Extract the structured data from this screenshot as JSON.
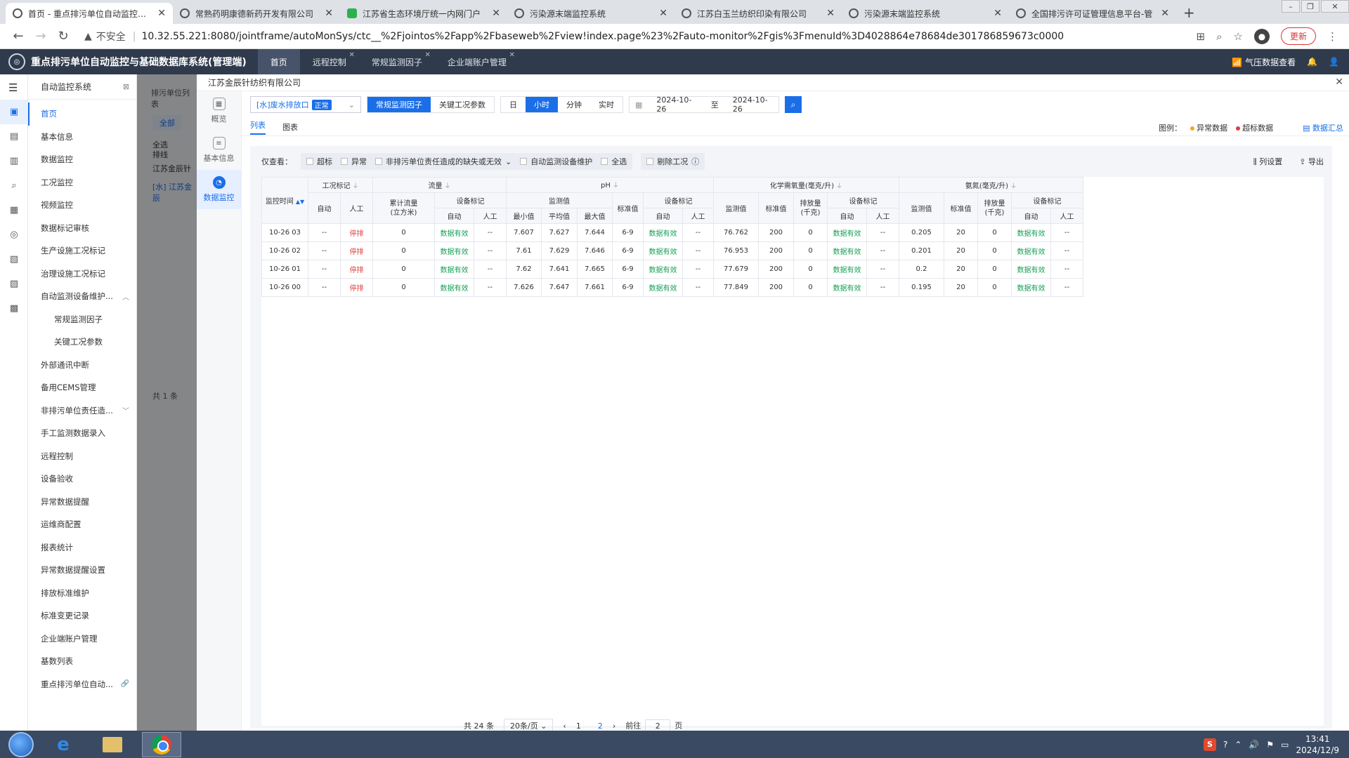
{
  "browser": {
    "tabs": [
      {
        "label": "首页 - 重点排污单位自动监控与基",
        "active": true,
        "green": false
      },
      {
        "label": "常熟药明康德新药开发有限公司",
        "active": false,
        "green": false
      },
      {
        "label": "江苏省生态环境厅统一内网门户",
        "active": false,
        "green": true
      },
      {
        "label": "污染源末端监控系统",
        "active": false,
        "green": false
      },
      {
        "label": "江苏白玉兰纺织印染有限公司",
        "active": false,
        "green": false
      },
      {
        "label": "污染源末端监控系统",
        "active": false,
        "green": false
      },
      {
        "label": "全国排污许可证管理信息平台-管",
        "active": false,
        "green": false
      }
    ],
    "insecure_label": "不安全",
    "url": "10.32.55.221:8080/jointframe/autoMonSys/ctc__%2Fjointos%2Fapp%2Fbaseweb%2Fview!index.page%23%2Fauto-monitor%2Fgis%3FmenuId%3D4028864e78684de301786859673c0000",
    "update_label": "更新"
  },
  "app": {
    "title": "重点排污单位自动监控与基础数据库系统(管理端)",
    "tabs": [
      "首页",
      "远程控制",
      "常规监测因子",
      "企业端账户管理"
    ],
    "right_link": "气压数据查看"
  },
  "sidebar": {
    "title": "自动监控系统",
    "items": [
      {
        "label": "首页",
        "active": true,
        "sub": false,
        "chev": ""
      },
      {
        "label": "基本信息",
        "active": false,
        "sub": false,
        "chev": ""
      },
      {
        "label": "数据监控",
        "active": false,
        "sub": false,
        "chev": ""
      },
      {
        "label": "工况监控",
        "active": false,
        "sub": false,
        "chev": ""
      },
      {
        "label": "视频监控",
        "active": false,
        "sub": false,
        "chev": ""
      },
      {
        "label": "数据标记审核",
        "active": false,
        "sub": false,
        "chev": ""
      },
      {
        "label": "生产设施工况标记",
        "active": false,
        "sub": false,
        "chev": ""
      },
      {
        "label": "治理设施工况标记",
        "active": false,
        "sub": false,
        "chev": ""
      },
      {
        "label": "自动监测设备维护...",
        "active": false,
        "sub": false,
        "chev": "︿"
      },
      {
        "label": "常规监测因子",
        "active": false,
        "sub": true,
        "chev": ""
      },
      {
        "label": "关键工况参数",
        "active": false,
        "sub": true,
        "chev": ""
      },
      {
        "label": "外部通讯中断",
        "active": false,
        "sub": false,
        "chev": ""
      },
      {
        "label": "备用CEMS管理",
        "active": false,
        "sub": false,
        "chev": ""
      },
      {
        "label": "非排污单位责任造...",
        "active": false,
        "sub": false,
        "chev": "﹀"
      },
      {
        "label": "手工监测数据录入",
        "active": false,
        "sub": false,
        "chev": ""
      },
      {
        "label": "远程控制",
        "active": false,
        "sub": false,
        "chev": ""
      },
      {
        "label": "设备验收",
        "active": false,
        "sub": false,
        "chev": ""
      },
      {
        "label": "异常数据提醒",
        "active": false,
        "sub": false,
        "chev": ""
      },
      {
        "label": "运维商配置",
        "active": false,
        "sub": false,
        "chev": ""
      },
      {
        "label": "报表统计",
        "active": false,
        "sub": false,
        "chev": ""
      },
      {
        "label": "异常数据提醒设置",
        "active": false,
        "sub": false,
        "chev": ""
      },
      {
        "label": "排放标准维护",
        "active": false,
        "sub": false,
        "chev": ""
      },
      {
        "label": "标准变更记录",
        "active": false,
        "sub": false,
        "chev": ""
      },
      {
        "label": "企业端账户管理",
        "active": false,
        "sub": false,
        "chev": ""
      },
      {
        "label": "基数列表",
        "active": false,
        "sub": false,
        "chev": ""
      },
      {
        "label": "重点排污单位自动...",
        "active": false,
        "sub": false,
        "chev": "🔗"
      }
    ]
  },
  "background_page": {
    "title": "排污单位列表",
    "all_button": "全部",
    "check_all": "全选",
    "check_waste": "排线",
    "company": "江苏金辰针",
    "item": "[水] 江苏金辰",
    "total": "共 1 条"
  },
  "modal": {
    "title": "江苏金辰针纺织有限公司",
    "rail": [
      {
        "label": "概览",
        "icon": "▦",
        "active": false
      },
      {
        "label": "基本信息",
        "icon": "≡",
        "active": false
      },
      {
        "label": "数据监控",
        "icon": "◔",
        "active": true
      }
    ],
    "outlet_prefix": "[水]",
    "outlet_name": "废水排放口",
    "outlet_status": "正常",
    "factor_tabs": [
      {
        "label": "常规监测因子",
        "on": true
      },
      {
        "label": "关键工况参数",
        "on": false
      }
    ],
    "time_tabs": [
      {
        "label": "日",
        "on": false
      },
      {
        "label": "小时",
        "on": true
      },
      {
        "label": "分钟",
        "on": false
      },
      {
        "label": "实时",
        "on": false
      }
    ],
    "date_from": "2024-10-26",
    "date_to_sep": "至",
    "date_to": "2024-10-26",
    "view_tabs": [
      {
        "label": "列表",
        "on": true
      },
      {
        "label": "图表",
        "on": false
      }
    ],
    "legend_label": "图例：",
    "legend_abnormal": "异常数据",
    "legend_over": "超标数据",
    "legend_abnormal_color": "#f5a623",
    "legend_over_color": "#e03c3c",
    "summary": "数据汇总",
    "filter_label": "仅查看：",
    "filters": [
      "超标",
      "异常",
      "非排污单位责任造成的缺失或无效",
      "自动监测设备维护",
      "全选"
    ],
    "delete_cond": "剔除工况",
    "col_setting": "列设置",
    "export": "导出"
  },
  "table": {
    "time_header": "监控时间",
    "groups": {
      "cond": "工况标记",
      "flow": "流量",
      "ph": "pH",
      "cod": "化学需氧量(毫克/升)",
      "nh3": "氨氮(毫克/升)"
    },
    "sub": {
      "auto": "自动",
      "manual": "人工",
      "cumflow_1": "累计流量",
      "cumflow_2": "(立方米)",
      "dev": "设备标记",
      "measured": "监测值",
      "std": "标准值",
      "discharge_1": "排放量",
      "discharge_2": "(千克)",
      "min": "最小值",
      "avg": "平均值",
      "max": "最大值"
    },
    "rows": [
      {
        "time": "10-26 03",
        "c_auto": "--",
        "c_man": "停排",
        "flow": "0",
        "f_auto": "数据有效",
        "f_man": "--",
        "ph_min": "7.607",
        "ph_avg": "7.627",
        "ph_max": "7.644",
        "ph_std": "6-9",
        "ph_auto": "数据有效",
        "ph_man": "--",
        "cod_val": "76.762",
        "cod_std": "200",
        "cod_dis": "0",
        "cod_auto": "数据有效",
        "cod_man": "--",
        "nh_val": "0.205",
        "nh_std": "20",
        "nh_dis": "0",
        "nh_auto": "数据有效",
        "nh_man": "--"
      },
      {
        "time": "10-26 02",
        "c_auto": "--",
        "c_man": "停排",
        "flow": "0",
        "f_auto": "数据有效",
        "f_man": "--",
        "ph_min": "7.61",
        "ph_avg": "7.629",
        "ph_max": "7.646",
        "ph_std": "6-9",
        "ph_auto": "数据有效",
        "ph_man": "--",
        "cod_val": "76.953",
        "cod_std": "200",
        "cod_dis": "0",
        "cod_auto": "数据有效",
        "cod_man": "--",
        "nh_val": "0.201",
        "nh_std": "20",
        "nh_dis": "0",
        "nh_auto": "数据有效",
        "nh_man": "--"
      },
      {
        "time": "10-26 01",
        "c_auto": "--",
        "c_man": "停排",
        "flow": "0",
        "f_auto": "数据有效",
        "f_man": "--",
        "ph_min": "7.62",
        "ph_avg": "7.641",
        "ph_max": "7.665",
        "ph_std": "6-9",
        "ph_auto": "数据有效",
        "ph_man": "--",
        "cod_val": "77.679",
        "cod_std": "200",
        "cod_dis": "0",
        "cod_auto": "数据有效",
        "cod_man": "--",
        "nh_val": "0.2",
        "nh_std": "20",
        "nh_dis": "0",
        "nh_auto": "数据有效",
        "nh_man": "--"
      },
      {
        "time": "10-26 00",
        "c_auto": "--",
        "c_man": "停排",
        "flow": "0",
        "f_auto": "数据有效",
        "f_man": "--",
        "ph_min": "7.626",
        "ph_avg": "7.647",
        "ph_max": "7.661",
        "ph_std": "6-9",
        "ph_auto": "数据有效",
        "ph_man": "--",
        "cod_val": "77.849",
        "cod_std": "200",
        "cod_dis": "0",
        "cod_auto": "数据有效",
        "cod_man": "--",
        "nh_val": "0.195",
        "nh_std": "20",
        "nh_dis": "0",
        "nh_auto": "数据有效",
        "nh_man": "--"
      }
    ]
  },
  "pager": {
    "total": "共 24 条",
    "size": "20条/页",
    "pages": [
      "1",
      "2"
    ],
    "current": "2",
    "goto_label": "前往",
    "goto_value": "2",
    "page_unit": "页"
  },
  "taskbar": {
    "time": "13:41",
    "date": "2024/12/9"
  }
}
